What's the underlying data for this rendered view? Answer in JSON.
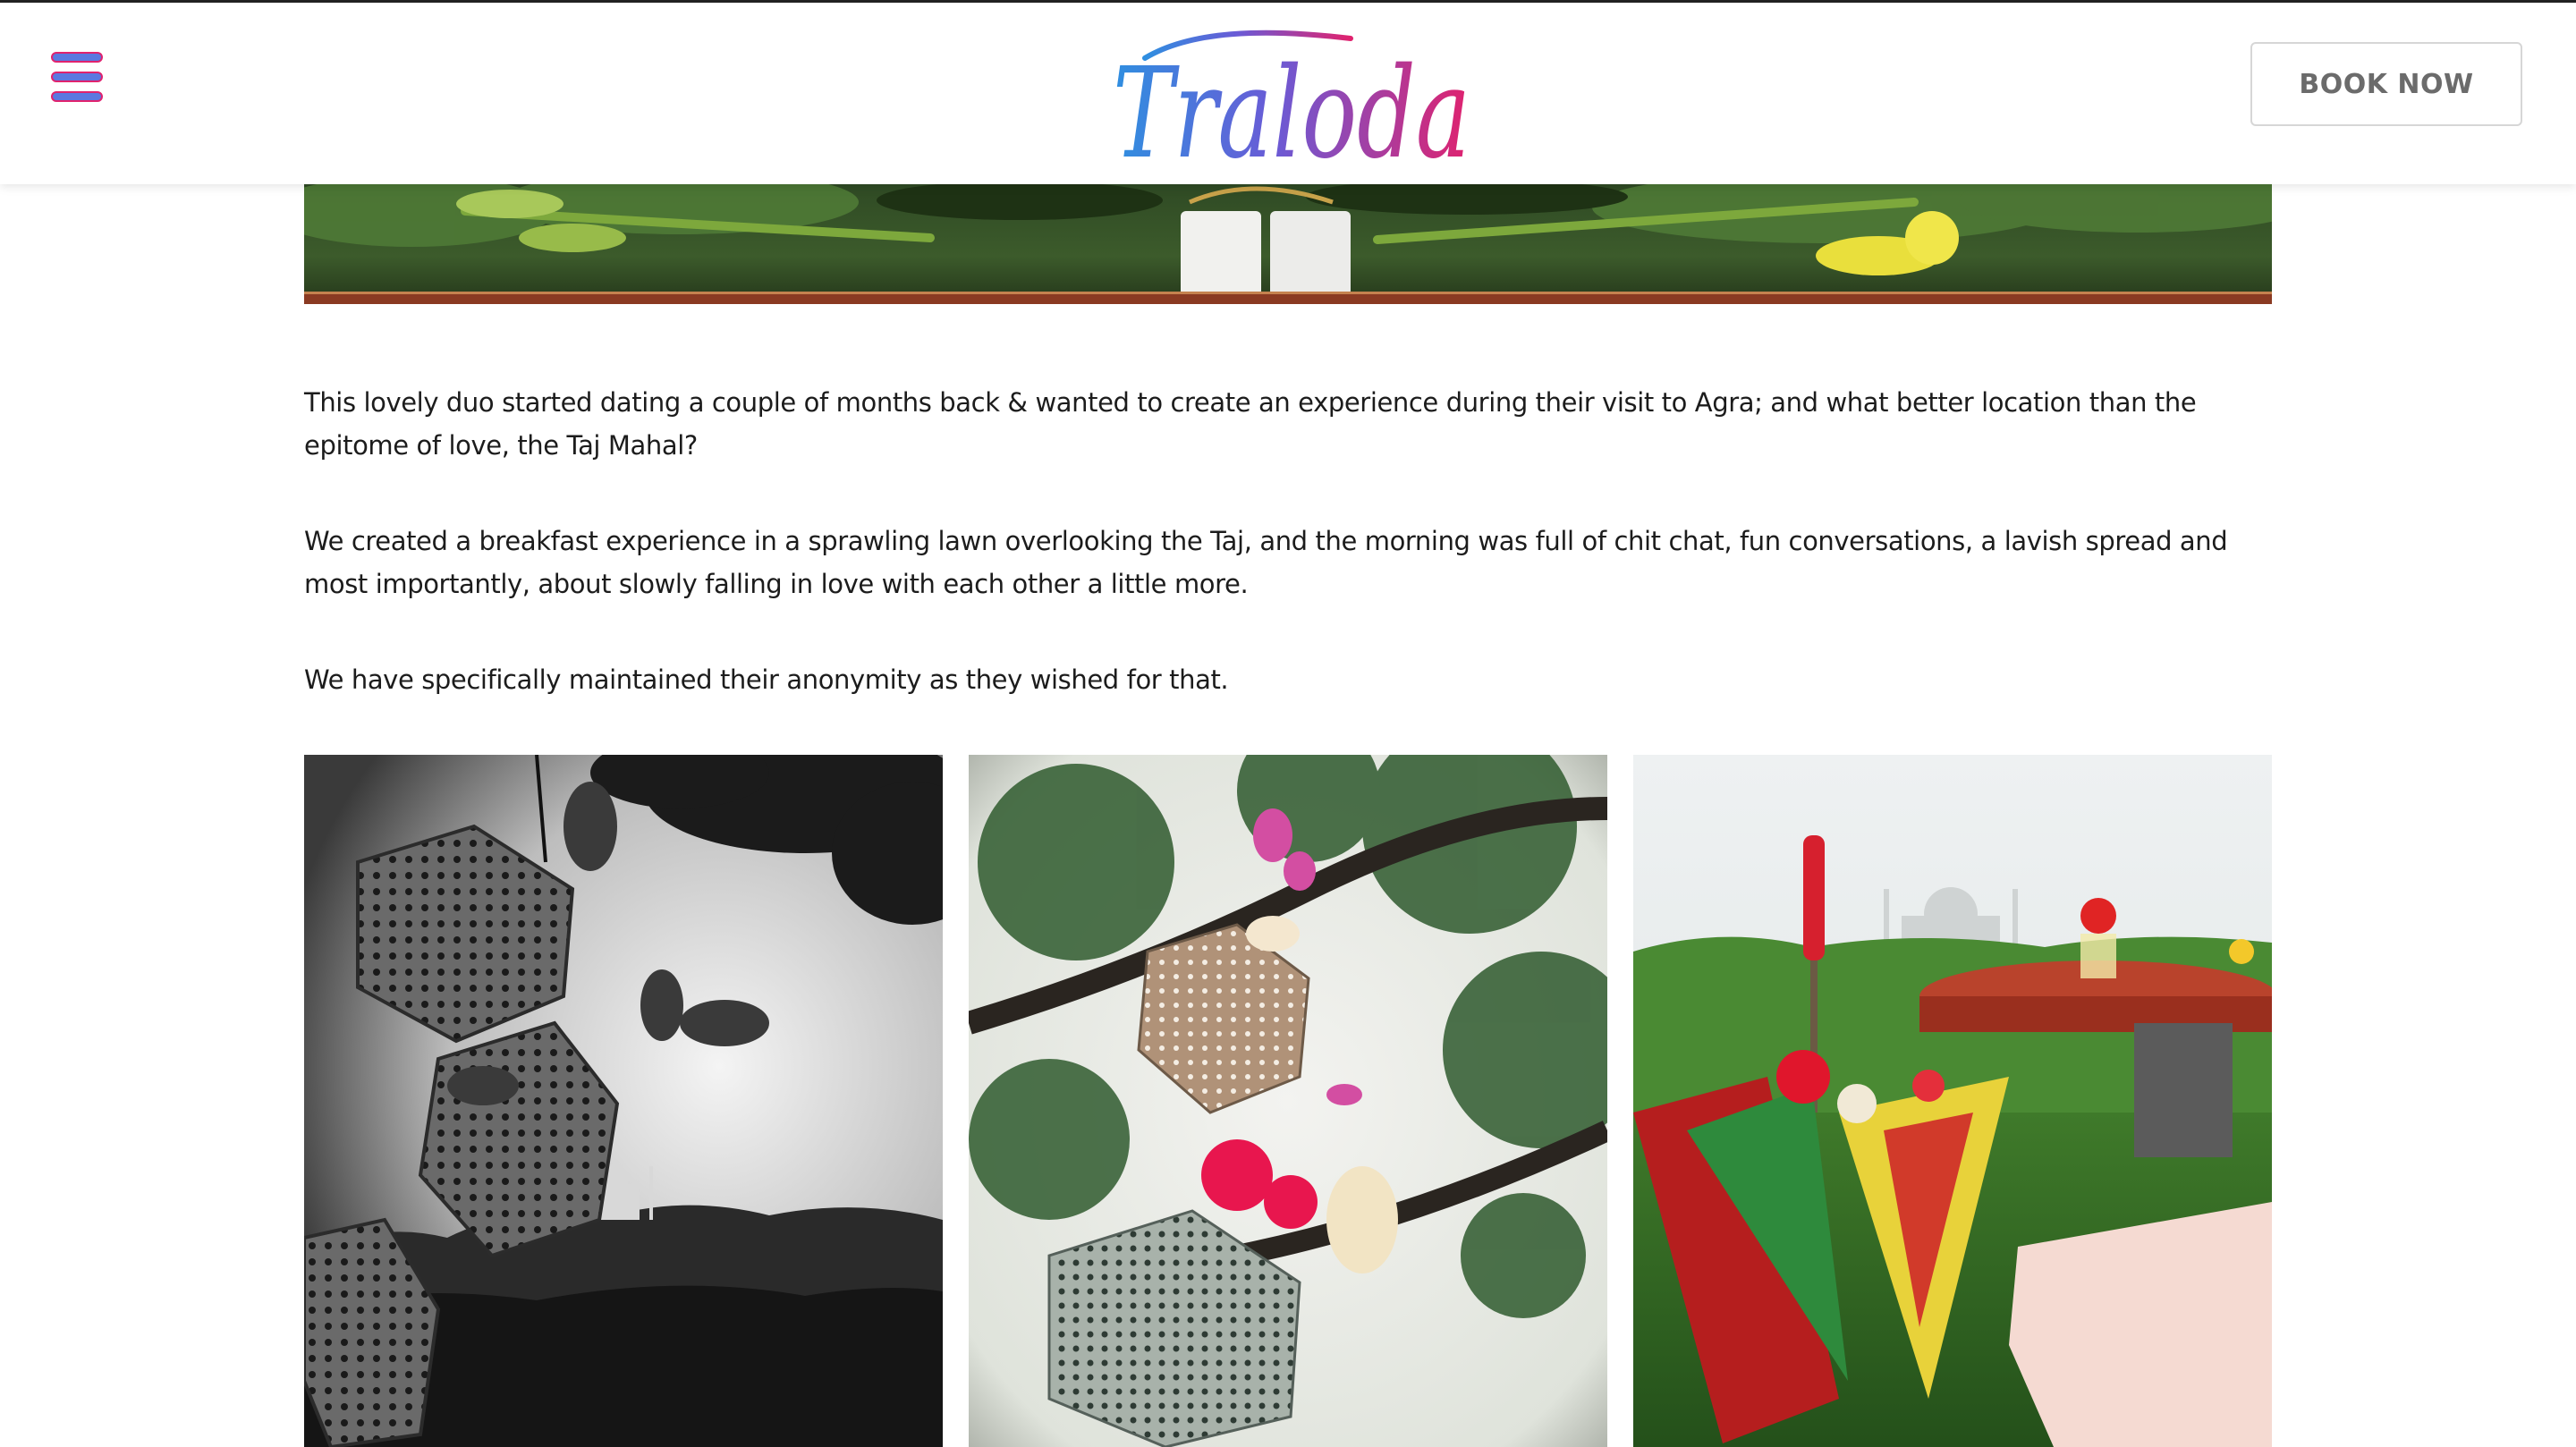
{
  "header": {
    "menu_icon": "hamburger-menu-icon",
    "logo_text": "Traloda",
    "book_now_label": "BOOK NOW"
  },
  "article": {
    "paragraphs": [
      "This lovely duo started dating a couple of months back & wanted to create an experience during their visit to Agra; and what better location than the epitome of love, the Taj Mahal?",
      "We created a breakfast experience in a sprawling lawn overlooking the Taj, and the morning was full of chit chat, fun conversations, a lavish spread and most importantly, about slowly falling in love with each other a little more.",
      "We have specifically maintained their anonymity as they wished for that."
    ]
  },
  "colors": {
    "logo_gradient_start": "#2f8fe0",
    "logo_gradient_mid": "#6a5bd6",
    "logo_gradient_end": "#e0226e",
    "menu_fill": "#5b78e0",
    "menu_outline": "#e0226e",
    "button_text": "#6b6b6b"
  }
}
